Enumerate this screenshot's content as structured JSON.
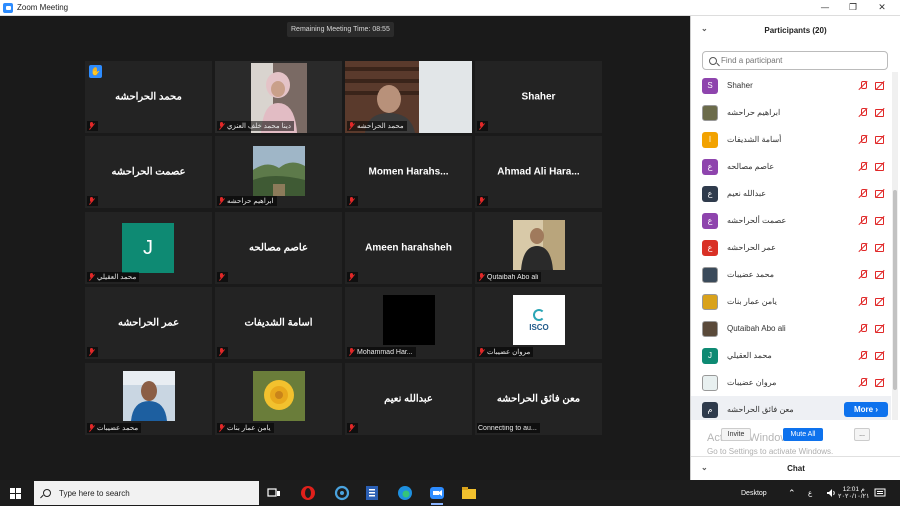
{
  "window": {
    "title": "Zoom Meeting",
    "minimize": "—",
    "restore": "❐",
    "close": "✕"
  },
  "meeting": {
    "timer": "Remaining Meeting Time: 08:55",
    "tiles": [
      {
        "name": "محمد الحراحشه",
        "label": "",
        "raised_hand": true
      },
      {
        "name": "",
        "label": "دينا محمد خلف العنزي",
        "active": true
      },
      {
        "name": "",
        "label": "محمد الحراحشه"
      },
      {
        "name": "Shaher",
        "label": ""
      },
      {
        "name": "عصمت ألحراحشه",
        "label": ""
      },
      {
        "name": "",
        "label": "ابراهيم حراحشه"
      },
      {
        "name": "Momen Harahs...",
        "label": ""
      },
      {
        "name": "Ahmad Ali Hara...",
        "label": ""
      },
      {
        "name": "",
        "label": "محمد العقيلي",
        "avatar_letter": "J"
      },
      {
        "name": "عاصم مصالحه",
        "label": ""
      },
      {
        "name": "Ameen harahsheh",
        "label": ""
      },
      {
        "name": "",
        "label": "Qutaibah Abo ali"
      },
      {
        "name": "عمر الحراحشه",
        "label": ""
      },
      {
        "name": "أسامة الشديفات",
        "label": ""
      },
      {
        "name": "",
        "label": "Mohammad Har..."
      },
      {
        "name": "",
        "label": "مروان عضيبات",
        "logo_text": "ISCO"
      },
      {
        "name": "",
        "label": "محمد عضيبات"
      },
      {
        "name": "",
        "label": "يامن عمار بنات"
      },
      {
        "name": "عبدالله نعيم",
        "label": ""
      },
      {
        "name": "معن فائق الحراحشه",
        "label": "Connecting to au..."
      }
    ]
  },
  "participants": {
    "title": "Participants (20)",
    "search_placeholder": "Find a participant",
    "list": [
      {
        "name": "Shaher",
        "avatar": "S",
        "color": "#8e44ad"
      },
      {
        "name": "ابراهيم حراحشه",
        "avatar": "",
        "color": "#6b6b4a"
      },
      {
        "name": "أسامة الشديفات",
        "avatar": "ا",
        "color": "#f2a200"
      },
      {
        "name": "عاصم مصالحه",
        "avatar": "ع",
        "color": "#8e44ad"
      },
      {
        "name": "عبدالله نعيم",
        "avatar": "ع",
        "color": "#2f3b4c"
      },
      {
        "name": "عصمت ألحراحشه",
        "avatar": "ع",
        "color": "#8e44ad"
      },
      {
        "name": "عمر الحراحشه",
        "avatar": "ع",
        "color": "#d93025"
      },
      {
        "name": "محمد عضيبات",
        "avatar": "",
        "color": "#3a4a5a"
      },
      {
        "name": "يامن عمار بنات",
        "avatar": "",
        "color": "#d9a21b"
      },
      {
        "name": "Qutaibah Abo ali",
        "avatar": "",
        "color": "#5a4a3a"
      },
      {
        "name": "محمد العقيلي",
        "avatar": "J",
        "color": "#0e8a73"
      },
      {
        "name": "مروان عضيبات",
        "avatar": "",
        "color": "#e8f0f0"
      },
      {
        "name": "معن فائق الحراحشه",
        "avatar": "م",
        "color": "#2f3b4c"
      }
    ],
    "more_button": "More ›",
    "invite_button": "Invite",
    "mute_all_button": "Mute All",
    "ellipsis_button": "...",
    "watermark_title": "Activate Windows",
    "watermark_sub": "Go to Settings to activate Windows.",
    "chat_title": "Chat"
  },
  "taskbar": {
    "search_text": "Type here to search",
    "desktop_label": "Desktop",
    "lang": "ع",
    "time": "12:01 م",
    "date": "٢٠٢٠/١٠/٢١"
  }
}
